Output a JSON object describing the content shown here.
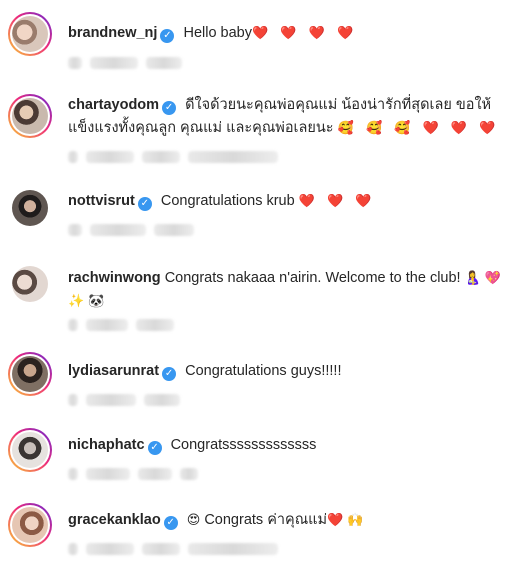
{
  "comments": [
    {
      "username": "brandnew_nj",
      "verified": true,
      "text": "Hello baby",
      "emoji": "❤️ ❤️ ❤️ ❤️"
    },
    {
      "username": "chartayodom",
      "verified": true,
      "text": "ดีใจด้วยนะคุณพ่อคุณแม่ น้องน่ารักที่สุดเลย ขอให้แข็งแรงทั้งคุณลูก คุณแม่ และคุณพ่อเลยนะ",
      "emoji": "🥰 🥰 🥰 ❤️ ❤️ ❤️"
    },
    {
      "username": "nottvisrut",
      "verified": true,
      "text": "Congratulations krub",
      "emoji": "❤️ ❤️ ❤️"
    },
    {
      "username": "rachwinwong",
      "verified": false,
      "text": "Congrats nakaaa n'airin. Welcome to the club!",
      "emoji": "🤱 💖 ✨ 🐼"
    },
    {
      "username": "lydiasarunrat",
      "verified": true,
      "text": "Congratulations guys!!!!!",
      "emoji": ""
    },
    {
      "username": "nichaphatc",
      "verified": true,
      "text": "Congratsssssssssssss",
      "emoji": ""
    },
    {
      "username": "gracekanklao",
      "verified": true,
      "text": "Congrats ค่าคุณแม่",
      "emoji_before": "😍",
      "emoji": "❤️ 🙌"
    }
  ],
  "icons": {
    "verified": "verified-check-icon"
  },
  "colors": {
    "verified": "#3897f0",
    "heart": "#ed2d3a",
    "ring_start": "#f9ce34",
    "ring_mid": "#ee2a7b",
    "ring_end": "#6228d7"
  }
}
